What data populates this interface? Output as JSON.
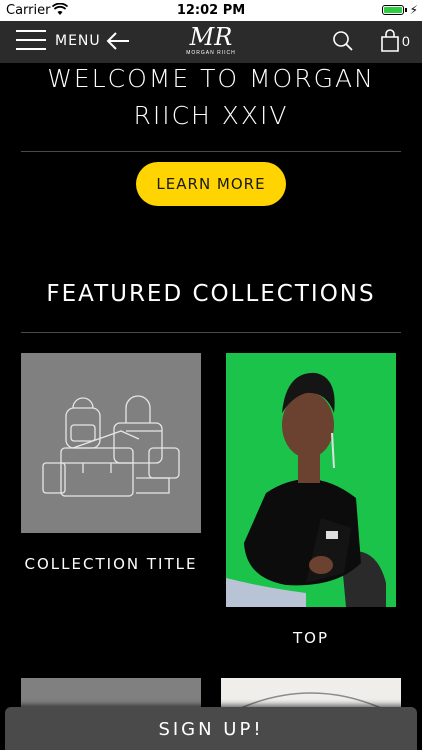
{
  "status_bar": {
    "carrier": "Carrier",
    "time": "12:02 PM",
    "battery_level": 1.0,
    "charging_icon": "bolt-icon"
  },
  "nav": {
    "menu_label": "MENU",
    "logo_text": "MR",
    "logo_subtext": "MORGAN RIICH",
    "cart_count": "0"
  },
  "hero": {
    "title_line1": "WELCOME TO MORGAN",
    "title_line2": "RIICH XXIV",
    "cta_label": "LEARN MORE",
    "cta_color": "#ffd400"
  },
  "featured": {
    "heading": "FEATURED COLLECTIONS",
    "collections": [
      {
        "title": "COLLECTION TITLE"
      },
      {
        "title": "TOP"
      }
    ]
  },
  "footer": {
    "signup_label": "SIGN UP!"
  }
}
